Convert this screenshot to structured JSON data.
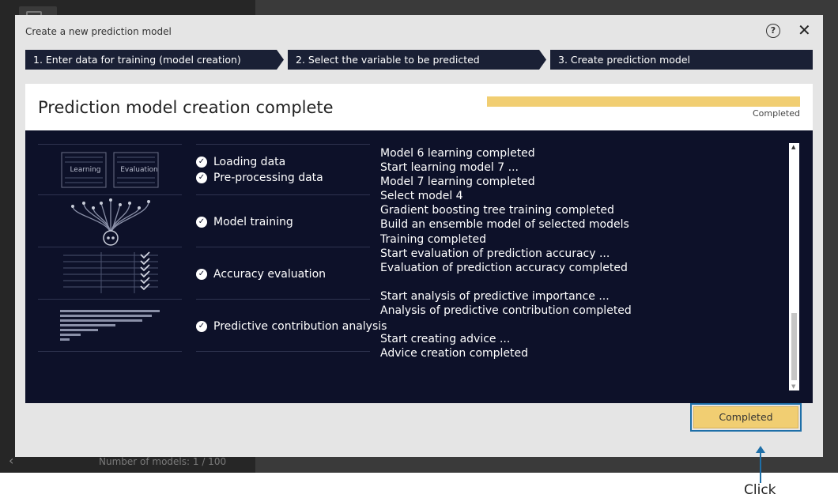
{
  "background": {
    "model_count_text": "Number of models: 1 / 100"
  },
  "dialog": {
    "title": "Create a new prediction model",
    "help_icon": "question-circle-icon",
    "close_icon": "close-x-icon"
  },
  "steps": [
    {
      "label": "1. Enter data for training (model creation)"
    },
    {
      "label": "2. Select the variable to be predicted"
    },
    {
      "label": "3. Create prediction model"
    }
  ],
  "panel": {
    "title": "Prediction model creation complete",
    "progress_label": "Completed",
    "progress_fraction": 1.0,
    "progress_color": "#f1ce72"
  },
  "stages": {
    "illustration_labels": [
      "Learning",
      "Evaluation"
    ],
    "items": [
      {
        "label": "Loading data"
      },
      {
        "label": "Pre-processing data"
      },
      {
        "label": "Model training"
      },
      {
        "label": "Accuracy evaluation"
      },
      {
        "label": "Predictive contribution analysis"
      }
    ]
  },
  "log": {
    "lines": [
      "Model 6 learning completed",
      "Start learning model 7 ...",
      "Model 7 learning completed",
      "Select model 4",
      "Gradient boosting tree training completed",
      "Build an ensemble model of selected models",
      "Training completed",
      "Start evaluation of prediction accuracy ...",
      "Evaluation of prediction accuracy completed",
      "",
      "Start analysis of predictive importance ...",
      "Analysis of predictive contribution completed",
      "",
      "Start creating advice ...",
      "Advice creation completed"
    ]
  },
  "footer": {
    "completed_button": "Completed"
  },
  "annotation": {
    "click_label": "Click",
    "color": "#1e6fa8"
  },
  "colors": {
    "dark_navy": "#0d1129",
    "step_bar": "#1a2035",
    "accent_yellow": "#f1ce72"
  }
}
